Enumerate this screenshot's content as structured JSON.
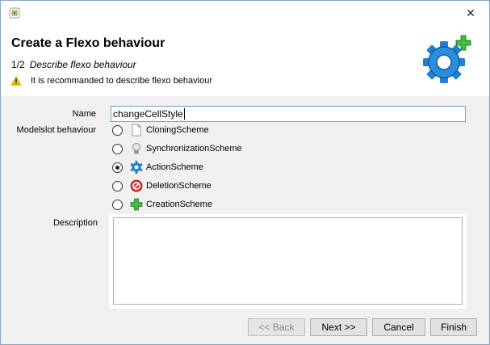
{
  "window": {
    "close_glyph": "✕"
  },
  "header": {
    "title": "Create a Flexo behaviour",
    "step_number": "1/2",
    "step_description": "Describe flexo behaviour",
    "warning": "It is recommanded to describe flexo behaviour"
  },
  "form": {
    "name_label": "Name",
    "name_value": "changeCellStyle",
    "modelslot_label": "Modelslot behaviour",
    "description_label": "Description",
    "description_value": "",
    "options": [
      {
        "label": "CloningScheme",
        "icon": "page-icon",
        "checked": false
      },
      {
        "label": "SynchronizationScheme",
        "icon": "lightbulb-icon",
        "checked": false
      },
      {
        "label": "ActionScheme",
        "icon": "gear-icon",
        "checked": true
      },
      {
        "label": "DeletionScheme",
        "icon": "delete-icon",
        "checked": false
      },
      {
        "label": "CreationScheme",
        "icon": "plus-icon",
        "checked": false
      }
    ]
  },
  "buttons": {
    "back": "<< Back",
    "next": "Next >>",
    "cancel": "Cancel",
    "finish": "Finish"
  },
  "colors": {
    "gear_blue": "#1f7fd0",
    "plus_green": "#34a634",
    "delete_red": "#d92b2b",
    "warning_yellow": "#f2c200"
  }
}
